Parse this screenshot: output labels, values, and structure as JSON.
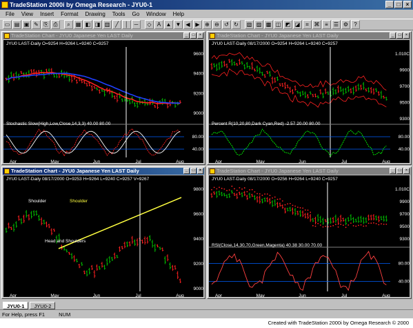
{
  "app": {
    "title": "TradeStation 2000i by Omega Research - JYU0-1",
    "credit": "Created with TradeStation 2000i by Omega Research © 2000"
  },
  "menu": [
    "File",
    "View",
    "Insert",
    "Format",
    "Drawing",
    "Tools",
    "Go",
    "Window",
    "Help"
  ],
  "windows": [
    {
      "title": "TradeStation Chart - JYU0 Japanese Yen LAST Daily",
      "active": false,
      "price_header": "JYU0 LAST-Daily  O=9254  H=9264  L=9240  C=9257",
      "indicator_label": "Stochastic Slow(High,Low,Close,14,3,3)  40.00  80.00",
      "axis": [
        "9600",
        "9400",
        "9200",
        "9000",
        "80.00",
        "40.00"
      ],
      "dates": [
        "Apr",
        "May",
        "Jun",
        "Jul",
        "Aug"
      ]
    },
    {
      "title": "TradeStation Chart - JYU0 Japanese Yen LAST Daily",
      "active": false,
      "price_header": "JYU0 LAST-Daily  08/17/2000  O=9254  H=9264  L=9240  C=9257",
      "indicator_label": "Percent R(10,20,80,Dark Cyan,Red)  -2.57  20.00  80.00",
      "axis": [
        "1.010C",
        "9900",
        "9700",
        "9500",
        "9300",
        "80.00",
        "40.00"
      ],
      "dates": [
        "Apr",
        "May",
        "Jun",
        "Jul",
        "Aug"
      ]
    },
    {
      "title": "TradeStation Chart - JYU0 Japanese Yen LAST Daily",
      "active": true,
      "price_header": "JYU0 LAST-Daily  08/17/2000  O=9253  H=9264  L=9240  C=9257  V=9267",
      "annotations": {
        "left_shoulder": "Shoulder",
        "right_shoulder": "Shoulder",
        "neckline": "Head and Shoulders"
      },
      "axis": [
        "9800",
        "9600",
        "9400",
        "9200",
        "9000"
      ],
      "dates": [
        "Apr",
        "May",
        "Jun",
        "Jul",
        "Aug"
      ]
    },
    {
      "title": "TradeStation Chart - JYU0 Japanese Yen LAST Daily",
      "active": false,
      "price_header": "JYU0 LAST-Daily  08/17/2000  O=9256  H=9264  L=9240  C=9257",
      "indicator_label": "RSI(Close,14,30,70,Green,Magenta)  40.38  30.00  70.00",
      "axis": [
        "1.010C",
        "9900",
        "9700",
        "9500",
        "9300",
        "80.00",
        "40.00"
      ],
      "dates": [
        "Apr",
        "May",
        "Jun",
        "Jul",
        "Aug"
      ]
    }
  ],
  "tabs": [
    "JYU0-1",
    "JYU0-2"
  ],
  "status": [
    "For Help, press F1",
    "NUM"
  ],
  "colors": {
    "up_bar": "#00c000",
    "down_bar": "#ff2020",
    "ma_red": "#ff2020",
    "ma_blue": "#2040ff",
    "trendline": "#ffff40",
    "indicator_line": "#00ff00",
    "ref_line": "#0060ff"
  }
}
